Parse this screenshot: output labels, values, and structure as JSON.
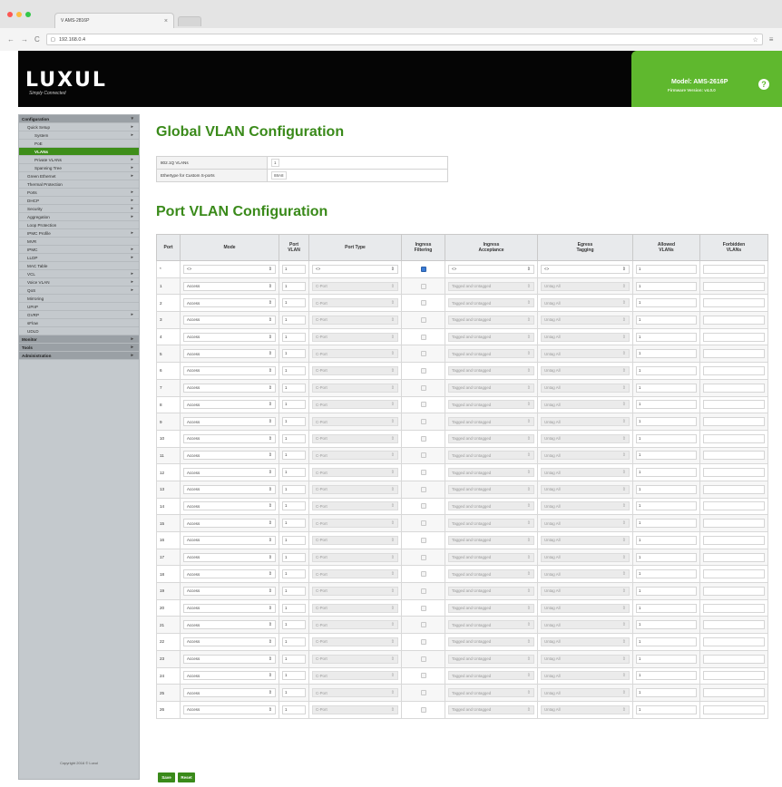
{
  "browser": {
    "tab_title": "V AMS-2816P",
    "url": "192.168.0.4",
    "back_icon": "arrow-left-icon",
    "forward_icon": "arrow-right-icon",
    "reload_icon": "reload-icon",
    "lights": [
      "#fc5753",
      "#fdbc40",
      "#33c748"
    ]
  },
  "header": {
    "logo": "LUXUL",
    "tagline": "Simply Connected",
    "model": "Model: AMS-2616P",
    "firmware": "Firmware Version: v4.0.0",
    "help_glyph": "?",
    "brand_color": "#5fb82e"
  },
  "sidebar": {
    "items": [
      {
        "label": "Configuration",
        "level": 1,
        "head": true,
        "arrow": "▾"
      },
      {
        "label": "Quick Setup",
        "level": 2,
        "head": false,
        "arrow": "▸"
      },
      {
        "label": "System",
        "level": 3,
        "head": false,
        "arrow": "▸"
      },
      {
        "label": "PoE",
        "level": 3,
        "head": false,
        "arrow": ""
      },
      {
        "label": "VLANs",
        "level": 3,
        "head": false,
        "active": true,
        "arrow": ""
      },
      {
        "label": "Private VLANs",
        "level": 3,
        "head": false,
        "arrow": "▸"
      },
      {
        "label": "Spanning Tree",
        "level": 3,
        "head": false,
        "arrow": "▸"
      },
      {
        "label": "Green Ethernet",
        "level": 2,
        "head": false,
        "arrow": "▸"
      },
      {
        "label": "Thermal Protection",
        "level": 2,
        "head": false,
        "arrow": ""
      },
      {
        "label": "Ports",
        "level": 2,
        "head": false,
        "arrow": "▸"
      },
      {
        "label": "DHCP",
        "level": 2,
        "head": false,
        "arrow": "▸"
      },
      {
        "label": "Security",
        "level": 2,
        "head": false,
        "arrow": "▸"
      },
      {
        "label": "Aggregation",
        "level": 2,
        "head": false,
        "arrow": "▸"
      },
      {
        "label": "Loop Protection",
        "level": 2,
        "head": false,
        "arrow": ""
      },
      {
        "label": "IPMC Profile",
        "level": 2,
        "head": false,
        "arrow": "▸"
      },
      {
        "label": "MVR",
        "level": 2,
        "head": false,
        "arrow": ""
      },
      {
        "label": "IPMC",
        "level": 2,
        "head": false,
        "arrow": "▸"
      },
      {
        "label": "LLDP",
        "level": 2,
        "head": false,
        "arrow": "▸"
      },
      {
        "label": "MAC Table",
        "level": 2,
        "head": false,
        "arrow": ""
      },
      {
        "label": "VCL",
        "level": 2,
        "head": false,
        "arrow": "▸"
      },
      {
        "label": "Voice VLAN",
        "level": 2,
        "head": false,
        "arrow": "▸"
      },
      {
        "label": "QoS",
        "level": 2,
        "head": false,
        "arrow": "▸"
      },
      {
        "label": "Mirroring",
        "level": 2,
        "head": false,
        "arrow": ""
      },
      {
        "label": "UPnP",
        "level": 2,
        "head": false,
        "arrow": ""
      },
      {
        "label": "GVRP",
        "level": 2,
        "head": false,
        "arrow": "▸"
      },
      {
        "label": "sFlow",
        "level": 2,
        "head": false,
        "arrow": ""
      },
      {
        "label": "UDLD",
        "level": 2,
        "head": false,
        "arrow": ""
      },
      {
        "label": "Monitor",
        "level": 1,
        "head": true,
        "arrow": "▸"
      },
      {
        "label": "Tools",
        "level": 1,
        "head": true,
        "arrow": "▸"
      },
      {
        "label": "Administration",
        "level": 1,
        "head": true,
        "arrow": "▸"
      }
    ],
    "copyright": "Copyright 2016 © Luxul"
  },
  "global": {
    "title": "Global VLAN Configuration",
    "rows": [
      {
        "label": "802.1Q VLANs",
        "value": "1"
      },
      {
        "label": "Ethertype for Custom S-ports",
        "value": "88A8"
      }
    ]
  },
  "port": {
    "title": "Port VLAN Configuration",
    "headers": {
      "port": "Port",
      "mode": "Mode",
      "pvlan_1": "Port",
      "pvlan_2": "VLAN",
      "type": "Port Type",
      "ingress_f_1": "Ingress",
      "ingress_f_2": "Filtering",
      "ingress_a_1": "Ingress",
      "ingress_a_2": "Acceptance",
      "egress_1": "Egress",
      "egress_2": "Tagging",
      "allowed_1": "Allowed",
      "allowed_2": "VLANs",
      "forbidden_1": "Forbidden",
      "forbidden_2": "VLANs"
    },
    "wildcard_row": {
      "port": "*",
      "mode": "<>",
      "pvlan": "1",
      "type": "<>",
      "acceptance": "<>",
      "egress": "<>",
      "allowed": "1",
      "forbidden": ""
    },
    "row_defaults": {
      "mode": "Access",
      "pvlan": "1",
      "type": "C-Port",
      "acceptance": "Tagged and Untagged",
      "egress": "Untag All",
      "allowed": "1",
      "forbidden": ""
    },
    "ports": [
      1,
      2,
      3,
      4,
      5,
      6,
      7,
      8,
      9,
      10,
      11,
      12,
      13,
      14,
      15,
      16,
      17,
      18,
      19,
      20,
      21,
      22,
      23,
      24,
      25,
      26
    ]
  },
  "buttons": {
    "save": "Save",
    "reset": "Reset"
  }
}
